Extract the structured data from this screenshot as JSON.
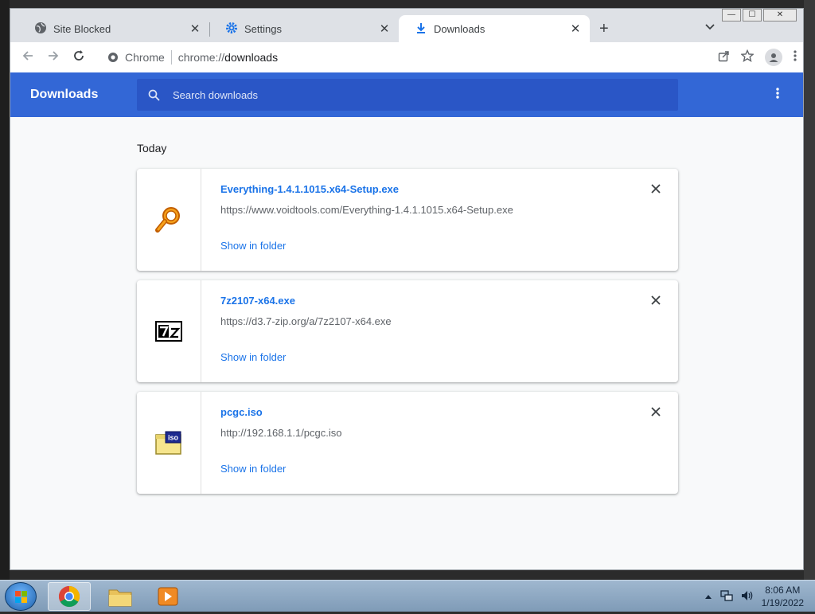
{
  "tabs": [
    {
      "title": "Site Blocked",
      "icon": "globe-icon"
    },
    {
      "title": "Settings",
      "icon": "gear-icon"
    },
    {
      "title": "Downloads",
      "icon": "download-icon",
      "active": true
    }
  ],
  "tab_close_glyph": "✕",
  "new_tab_glyph": "+",
  "window_controls": {
    "minimize": "—",
    "maximize": "☐",
    "close": "✕"
  },
  "omnibox": {
    "site_chip": "Chrome",
    "url_scheme": "chrome://",
    "url_host": "downloads"
  },
  "downloads_page": {
    "title": "Downloads",
    "search_placeholder": "Search downloads",
    "section": "Today",
    "items": [
      {
        "filename": "Everything-1.4.1.1015.x64-Setup.exe",
        "url": "https://www.voidtools.com/Everything-1.4.1.1015.x64-Setup.exe",
        "action": "Show in folder",
        "icon": "magnifier-icon"
      },
      {
        "filename": "7z2107-x64.exe",
        "url": "https://d3.7-zip.org/a/7z2107-x64.exe",
        "action": "Show in folder",
        "icon": "7zip-icon"
      },
      {
        "filename": "pcgc.iso",
        "url": "http://192.168.1.1/pcgc.iso",
        "action": "Show in folder",
        "icon": "iso-file-icon"
      }
    ]
  },
  "taskbar": {
    "time": "8:06 AM",
    "date": "1/19/2022"
  },
  "colors": {
    "header": "#3367d6",
    "search": "#2a56c6",
    "link": "#1a73e8"
  }
}
